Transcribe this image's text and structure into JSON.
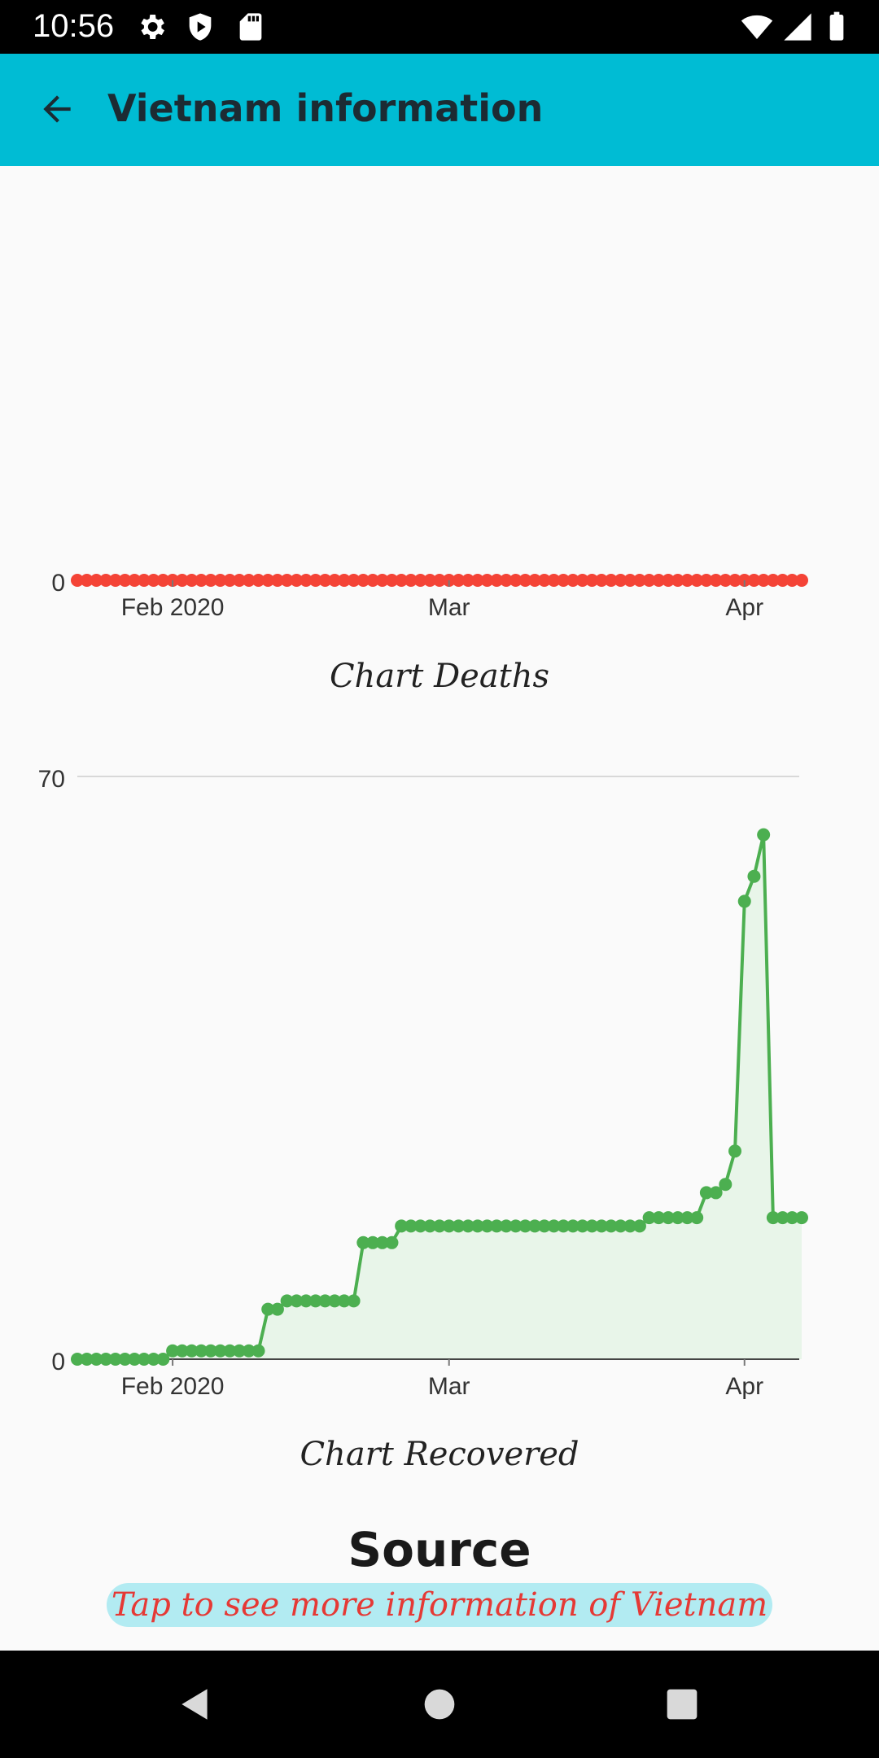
{
  "status_bar": {
    "time": "10:56",
    "left_icons": [
      "gear-icon",
      "shield-icon",
      "sd-card-icon"
    ],
    "right_icons": [
      "wifi-icon",
      "signal-icon",
      "battery-icon"
    ]
  },
  "app_bar": {
    "title": "Vietnam information",
    "background": "#00bcd4",
    "back_icon": "arrow-left-icon"
  },
  "chart_data": [
    {
      "type": "line",
      "caption": "Chart Deaths",
      "color": "#f44336",
      "x_tick_labels": [
        "Feb 2020",
        "Mar",
        "Apr"
      ],
      "y_tick_labels": [
        "0"
      ],
      "ylim": [
        0,
        0
      ],
      "x": "daily, 2020-01-22 to 2020-04-07",
      "series": [
        {
          "values": [
            0,
            0,
            0,
            0,
            0,
            0,
            0,
            0,
            0,
            0,
            0,
            0,
            0,
            0,
            0,
            0,
            0,
            0,
            0,
            0,
            0,
            0,
            0,
            0,
            0,
            0,
            0,
            0,
            0,
            0,
            0,
            0,
            0,
            0,
            0,
            0,
            0,
            0,
            0,
            0,
            0,
            0,
            0,
            0,
            0,
            0,
            0,
            0,
            0,
            0,
            0,
            0,
            0,
            0,
            0,
            0,
            0,
            0,
            0,
            0,
            0,
            0,
            0,
            0,
            0,
            0,
            0,
            0,
            0,
            0,
            0,
            0,
            0,
            0,
            0,
            0,
            0
          ]
        }
      ]
    },
    {
      "type": "area",
      "caption": "Chart Recovered",
      "color": "#4caf50",
      "x_tick_labels": [
        "Feb 2020",
        "Mar",
        "Apr"
      ],
      "y_tick_labels": [
        "0",
        "70"
      ],
      "ylim": [
        0,
        70
      ],
      "grid": true,
      "x": "daily, 2020-01-22 to 2020-04-07",
      "series": [
        {
          "values": [
            0,
            0,
            0,
            0,
            0,
            0,
            0,
            0,
            0,
            0,
            1,
            1,
            1,
            1,
            1,
            1,
            1,
            1,
            1,
            1,
            6,
            6,
            7,
            7,
            7,
            7,
            7,
            7,
            7,
            7,
            14,
            14,
            14,
            14,
            16,
            16,
            16,
            16,
            16,
            16,
            16,
            16,
            16,
            16,
            16,
            16,
            16,
            16,
            16,
            16,
            16,
            16,
            16,
            16,
            16,
            16,
            16,
            16,
            16,
            16,
            17,
            17,
            17,
            17,
            17,
            17,
            20,
            20,
            21,
            25,
            55,
            58,
            63,
            17,
            17,
            17,
            17
          ]
        }
      ]
    }
  ],
  "source": {
    "heading": "Source",
    "link_text": "Tap to see more information of Vietnam"
  },
  "nav_bar": {
    "icons": [
      "back-triangle-icon",
      "home-circle-icon",
      "recents-square-icon"
    ]
  }
}
